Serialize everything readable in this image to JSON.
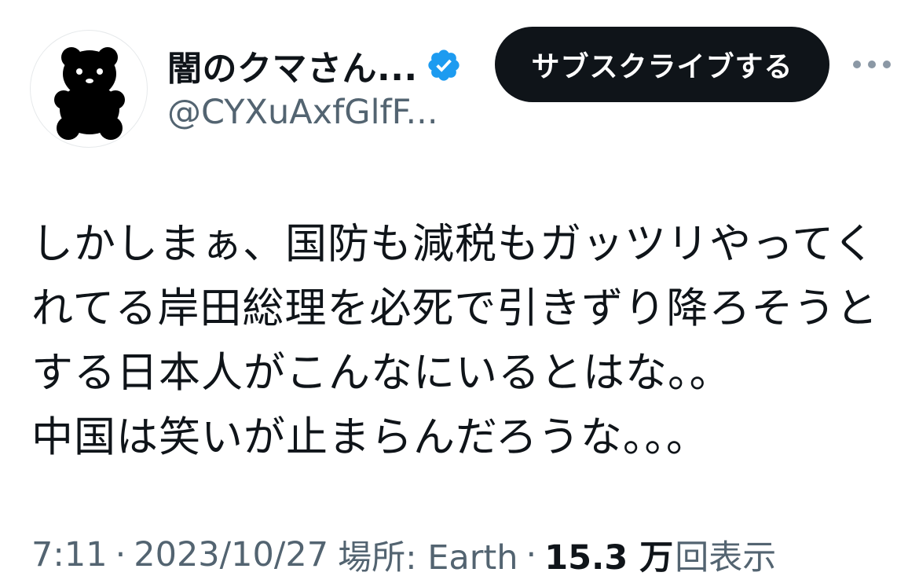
{
  "author": {
    "display_name": "闇のクマさん...",
    "handle": "@CYXuAxfGlfF...",
    "avatar": "black-bear-silhouette-icon",
    "verified_icon": "verified-badge-icon",
    "verified_color": "#1d9bf0"
  },
  "actions": {
    "subscribe_label": "サブスクライブする",
    "more_icon": "more-options-icon"
  },
  "tweet": {
    "lines": [
      "しかしまぁ、国防も減税もガッツリやってく",
      "れてる岸田総理を必死で引きずり降ろそうと",
      "する日本人がこんなにいるとはな。。",
      "中国は笑いが止まらんだろうな。。。"
    ]
  },
  "meta": {
    "time": "7:11",
    "separator": "·",
    "date": "2023/10/27",
    "location": "場所: Earth",
    "views_count": "15.3 万",
    "views_label": "回表示"
  },
  "colors": {
    "text_primary": "#0f1419",
    "text_secondary": "#536471",
    "button_bg": "#0f1419",
    "button_text": "#ffffff"
  }
}
